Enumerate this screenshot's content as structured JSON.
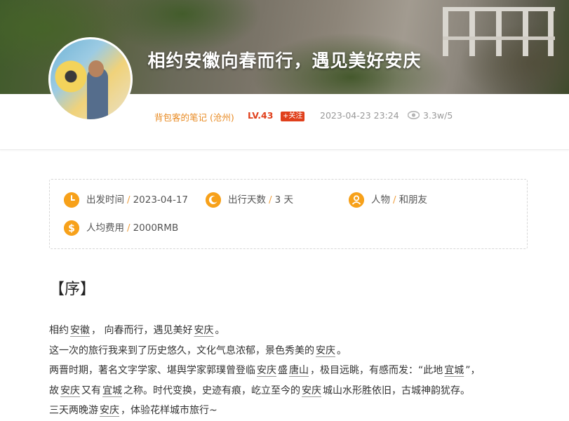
{
  "banner": {
    "title": "相约安徽向春而行，遇见美好安庆"
  },
  "author": {
    "name": "背包客的笔记 (沧州)",
    "level": "LV.43",
    "follow_label": "+关注",
    "date": "2023-04-23 23:24",
    "views": "3.3w/5"
  },
  "trip_info": {
    "depart": {
      "label": "出发时间",
      "value": "2023-04-17",
      "icon": "clock-icon"
    },
    "days": {
      "label": "出行天数",
      "value": "3 天",
      "icon": "moon-icon"
    },
    "people": {
      "label": "人物",
      "value": "和朋友",
      "icon": "person-icon"
    },
    "cost": {
      "label": "人均费用",
      "value": "2000RMB",
      "icon": "dollar-icon"
    }
  },
  "section_title": "【序】",
  "article": {
    "p1": {
      "a": "相约",
      "k1": "安徽",
      "b": "， 向春而行，遇见美好",
      "k2": "安庆",
      "c": "。"
    },
    "p2": {
      "a": "这一次的旅行我来到了历史悠久，文化气息浓郁，景色秀美的",
      "k1": "安庆",
      "b": "。"
    },
    "p3": {
      "a": "两晋时期，著名文字学家、堪舆学家郭璞曾登临",
      "k1": "安庆",
      "b": "盛",
      "k2": "唐山",
      "c": "，极目远眺，有感而发：“此地",
      "k3": "宜城",
      "d": "”，"
    },
    "p4": {
      "a": "故",
      "k1": "安庆",
      "b": "又有",
      "k2": "宜城",
      "c": "之称。时代变换，史迹有痕，屹立至今的",
      "k3": "安庆",
      "d": "城山水形胜依旧，古城神韵犹存。"
    },
    "p5": {
      "a": "三天两晚游",
      "k1": "安庆",
      "b": "，体验花样城市旅行~"
    }
  },
  "colors": {
    "accent": "#f7a11a",
    "author": "#e88a22",
    "level": "#e0401c"
  }
}
